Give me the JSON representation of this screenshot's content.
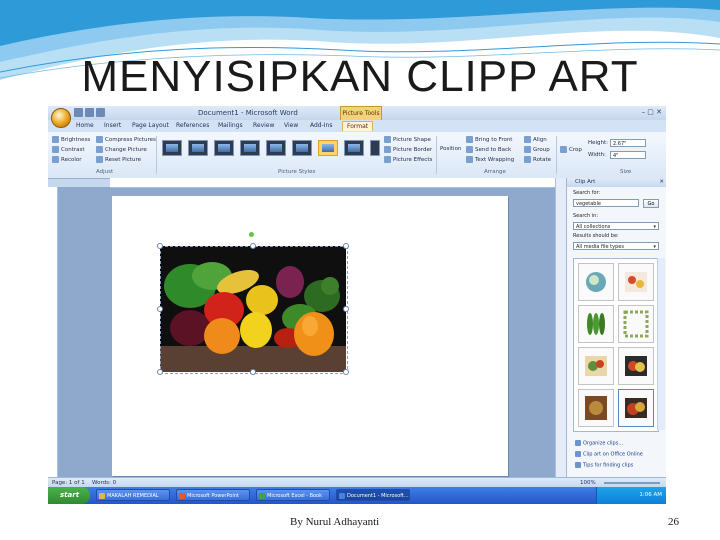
{
  "slide": {
    "title": "MENYISIPKAN CLIPP ART",
    "author": "By Nurul Adhayanti",
    "page_number": "26",
    "accent_colors": [
      "#2f9ad8",
      "#8ec9ef",
      "#b9dff5"
    ]
  },
  "word": {
    "window_title": "Document1 - Microsoft Word",
    "picture_tools_label": "Picture Tools",
    "window_controls": "– ▢ ✕",
    "tabs": [
      "Home",
      "Insert",
      "Page Layout",
      "References",
      "Mailings",
      "Review",
      "View",
      "Add-Ins",
      "Format"
    ],
    "active_tab": "Format",
    "ribbon": {
      "adjust": {
        "label": "Adjust",
        "items": [
          "Brightness",
          "Contrast",
          "Recolor",
          "Compress Pictures",
          "Change Picture",
          "Reset Picture"
        ]
      },
      "picture_styles": {
        "label": "Picture Styles",
        "items": [
          "Picture Shape",
          "Picture Border",
          "Picture Effects"
        ]
      },
      "arrange": {
        "label": "Arrange",
        "items": [
          "Position",
          "Bring to Front",
          "Send to Back",
          "Text Wrapping",
          "Align",
          "Group",
          "Rotate"
        ]
      },
      "size": {
        "label": "Size",
        "height_label": "Height:",
        "height_value": "2.67\"",
        "width_label": "Width:",
        "width_value": "4\"",
        "crop_label": "Crop"
      }
    },
    "status": {
      "page": "Page: 1 of 1",
      "words": "Words: 0",
      "zoom": "100%"
    },
    "clip_art_pane": {
      "title": "Clip Art",
      "search_for_label": "Search for:",
      "search_value": "vegetable",
      "go_label": "Go",
      "search_in_label": "Search in:",
      "search_in_value": "All collections",
      "results_label": "Results should be:",
      "results_value": "All media file types",
      "links": [
        "Organize clips...",
        "Clip art on Office Online",
        "Tips for finding clips"
      ]
    }
  },
  "taskbar": {
    "start_label": "start",
    "buttons": [
      "MAKALAH REMEDIAL",
      "Microsoft PowerPoint",
      "Microsoft Excel - Book",
      "Document1 - Microsoft..."
    ],
    "clock": "1:06 AM"
  }
}
